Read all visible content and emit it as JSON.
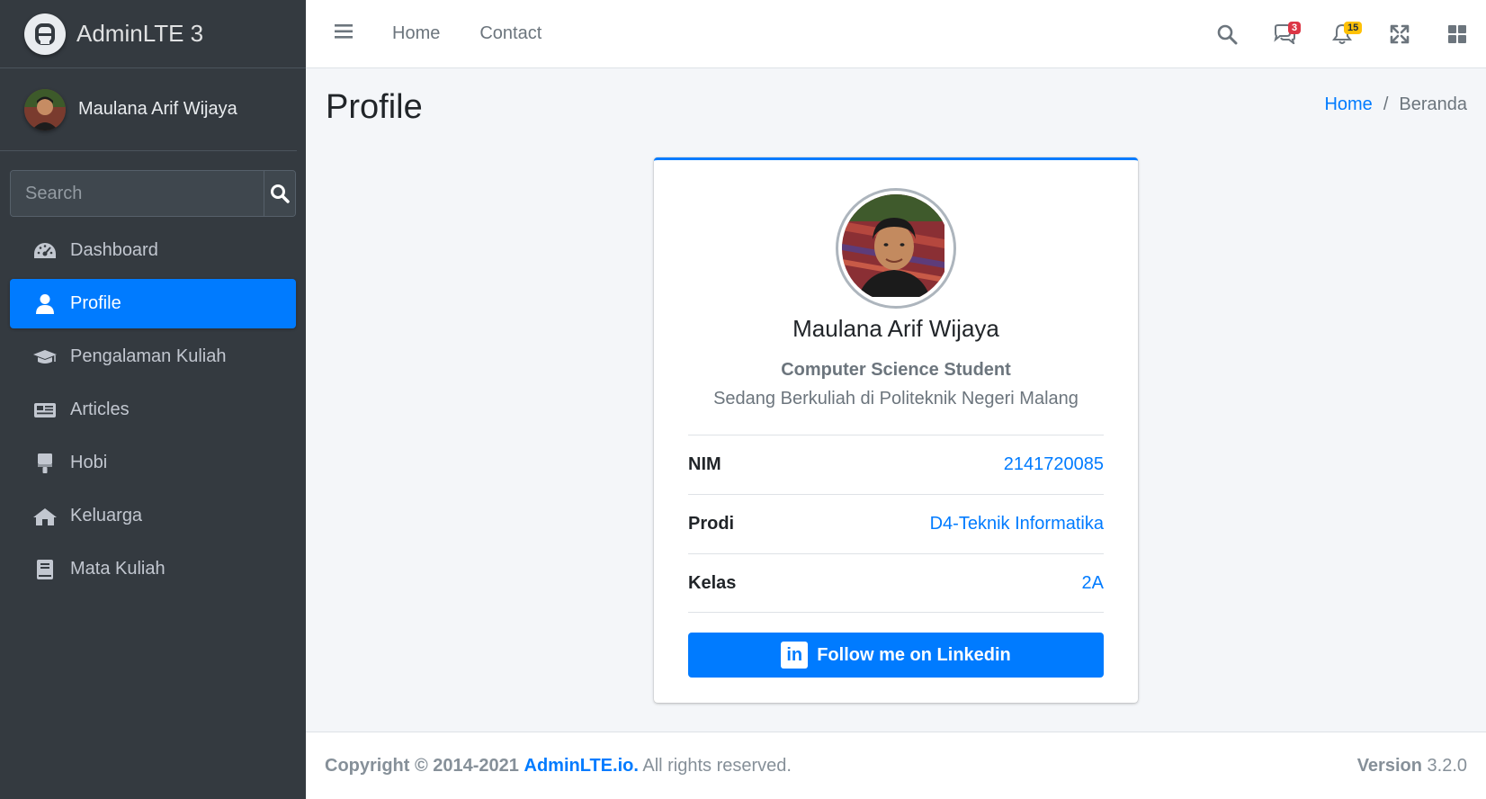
{
  "brand": {
    "name": "AdminLTE 3"
  },
  "user": {
    "name": "Maulana Arif Wijaya"
  },
  "search": {
    "placeholder": "Search"
  },
  "sidebar": {
    "items": [
      {
        "label": "Dashboard",
        "icon": "tachometer-icon",
        "active": false
      },
      {
        "label": "Profile",
        "icon": "user-icon",
        "active": true
      },
      {
        "label": "Pengalaman Kuliah",
        "icon": "graduation-cap-icon",
        "active": false
      },
      {
        "label": "Articles",
        "icon": "newspaper-icon",
        "active": false
      },
      {
        "label": "Hobi",
        "icon": "paint-brush-icon",
        "active": false
      },
      {
        "label": "Keluarga",
        "icon": "home-icon",
        "active": false
      },
      {
        "label": "Mata Kuliah",
        "icon": "book-icon",
        "active": false
      }
    ]
  },
  "topnav": {
    "links": [
      "Home",
      "Contact"
    ],
    "messages_badge": "3",
    "notifications_badge": "15"
  },
  "page": {
    "title": "Profile",
    "breadcrumb": {
      "home": "Home",
      "current": "Beranda"
    }
  },
  "profile": {
    "name": "Maulana Arif Wijaya",
    "role": "Computer Science Student",
    "description": "Sedang Berkuliah di Politeknik Negeri Malang",
    "fields": [
      {
        "label": "NIM",
        "value": "2141720085"
      },
      {
        "label": "Prodi",
        "value": "D4-Teknik Informatika"
      },
      {
        "label": "Kelas",
        "value": "2A"
      }
    ],
    "linkedin_button": "Follow me on Linkedin",
    "linkedin_icon_text": "in"
  },
  "footer": {
    "copyright_prefix": "Copyright © 2014-2021",
    "brand_link": "AdminLTE.io.",
    "rights": " All rights reserved.",
    "version_label": "Version",
    "version_value": " 3.2.0"
  },
  "colors": {
    "primary": "#007bff",
    "sidebar_bg": "#343a40",
    "content_bg": "#f4f6f9",
    "badge_red": "#dc3545",
    "badge_yellow": "#ffc107"
  }
}
